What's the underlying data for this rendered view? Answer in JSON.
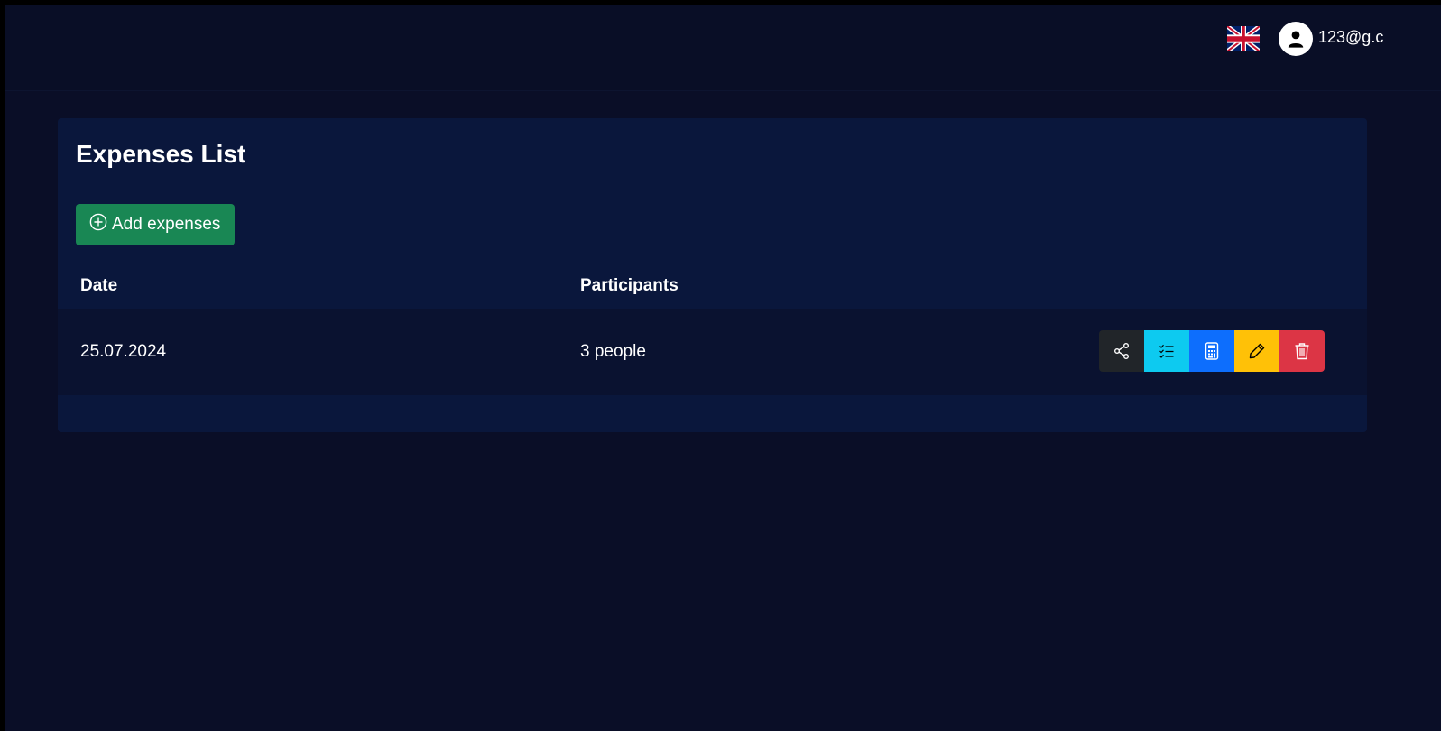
{
  "header": {
    "language": "English",
    "user_email": "123@g.c"
  },
  "main": {
    "title": "Expenses List",
    "add_button_label": "Add expenses",
    "table": {
      "columns": [
        "Date",
        "Participants"
      ],
      "rows": [
        {
          "date": "25.07.2024",
          "participants": "3 people"
        }
      ]
    },
    "row_actions": [
      "share",
      "list",
      "calculate",
      "edit",
      "delete"
    ]
  },
  "colors": {
    "background": "#0a0e27",
    "card": "#0a173c",
    "success": "#198754",
    "share": "#212529",
    "list": "#0dcaf0",
    "calculate": "#0d6efd",
    "edit": "#ffc107",
    "delete": "#dc3545"
  },
  "icons": [
    "uk-flag-icon",
    "user-icon",
    "plus-circle-icon",
    "share-icon",
    "checklist-icon",
    "calculator-icon",
    "pencil-icon",
    "trash-icon"
  ]
}
